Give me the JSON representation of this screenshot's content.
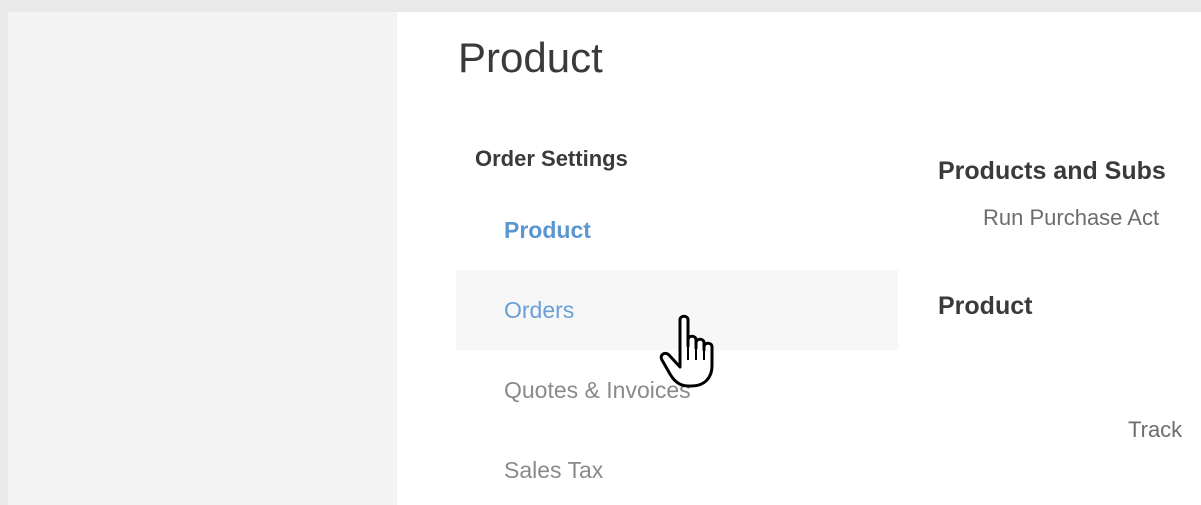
{
  "page": {
    "title": "Product"
  },
  "nav": {
    "heading": "Order Settings",
    "items": [
      {
        "label": "Product",
        "state": "active"
      },
      {
        "label": "Orders",
        "state": "hover"
      },
      {
        "label": "Quotes & Invoices",
        "state": "normal"
      },
      {
        "label": "Sales Tax",
        "state": "normal"
      }
    ]
  },
  "content": {
    "section1": {
      "title": "Products and Subs",
      "row": "Run Purchase Act"
    },
    "section2": {
      "title": "Product",
      "row": "Track"
    }
  },
  "cursor": {
    "icon": "hand-pointer-icon"
  },
  "colors": {
    "accent": "#5a96d1",
    "text": "#3a3a3a",
    "muted": "#8a8a8a"
  }
}
